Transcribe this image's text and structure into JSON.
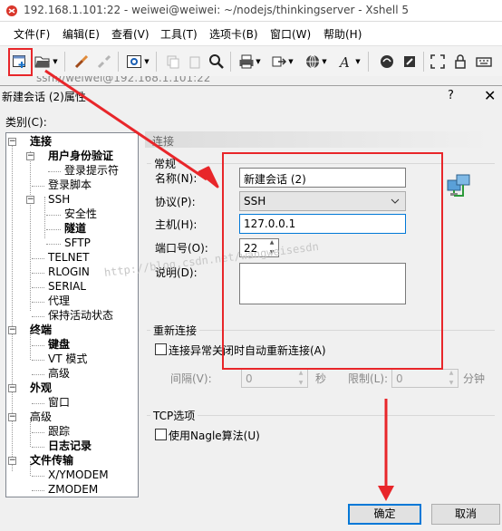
{
  "window": {
    "title": "192.168.1.101:22 - weiwei@weiwei: ~/nodejs/thinkingserver - Xshell 5",
    "address": "ssh://weiwei@192.168.1.101:22"
  },
  "menu": [
    "文件(F)",
    "编辑(E)",
    "查看(V)",
    "工具(T)",
    "选项卡(B)",
    "窗口(W)",
    "帮助(H)"
  ],
  "dialog": {
    "title": "新建会话 (2)属性",
    "help_label": "?",
    "close_label": "✕",
    "category_label": "类别(C):",
    "section_title": "连接",
    "ok_label": "确定",
    "cancel_label": "取消"
  },
  "tree": {
    "connection": "连接",
    "user_auth": "用户身份验证",
    "login_prompts": "登录提示符",
    "login_script": "登录脚本",
    "ssh": "SSH",
    "security": "安全性",
    "tunneling": "隧道",
    "sftp": "SFTP",
    "telnet": "TELNET",
    "rlogin": "RLOGIN",
    "serial": "SERIAL",
    "proxy": "代理",
    "keepalive": "保持活动状态",
    "terminal": "终端",
    "keyboard": "键盘",
    "vt_modes": "VT 模式",
    "advanced": "高级",
    "appearance": "外观",
    "window": "窗口",
    "advanced2": "高级",
    "trace": "跟踪",
    "logging": "日志记录",
    "file_transfer": "文件传输",
    "xymodem": "X/YMODEM",
    "zmodem": "ZMODEM"
  },
  "form": {
    "group_general": "常规",
    "name_label": "名称(N):",
    "name_value": "新建会话 (2)",
    "protocol_label": "协议(P):",
    "protocol_value": "SSH",
    "host_label": "主机(H):",
    "host_value": "127.0.0.1",
    "port_label": "端口号(O):",
    "port_value": "22",
    "desc_label": "说明(D):",
    "desc_value": ""
  },
  "reconnect": {
    "group_title": "重新连接",
    "checkbox_label": "连接异常关闭时自动重新连接(A)",
    "checked": false,
    "interval_label": "间隔(V):",
    "interval_value": "0",
    "seconds_label": "秒",
    "limit_label": "限制(L):",
    "limit_value": "0",
    "minutes_label": "分钟"
  },
  "tcp": {
    "group_title": "TCP选项",
    "nagle_label": "使用Nagle算法(U)",
    "nagle_checked": false
  },
  "watermark": "http://blog.csdn.net/wangweisesdn",
  "colors": {
    "annotation": "#e8262a",
    "focus": "#0078d7",
    "dialog_bg": "#f0f0f0"
  }
}
